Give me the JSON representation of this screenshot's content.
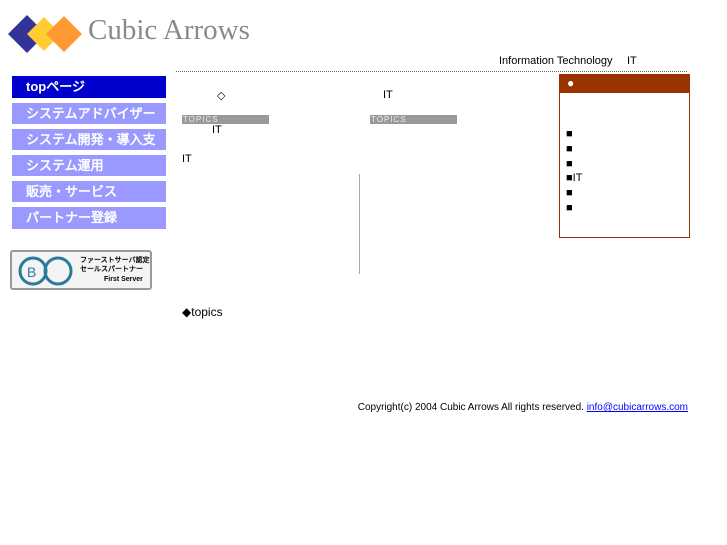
{
  "logo": {
    "text": "Cubic Arrows",
    "colors": [
      "#333399",
      "#ffcc33",
      "#ff9933"
    ]
  },
  "header": {
    "tagline": "Information Technology",
    "tag_it": "IT"
  },
  "nav": {
    "items": [
      {
        "label": "topページ",
        "active": true
      },
      {
        "label": "システムアドバイザー"
      },
      {
        "label": "システム開発・導入支援"
      },
      {
        "label": "システム運用"
      },
      {
        "label": "販売・サービス"
      },
      {
        "label": "パートナー登録"
      }
    ]
  },
  "banner": {
    "line1": "ファーストサーバ認定",
    "line2": "セールスパートナー",
    "brand": "First Server"
  },
  "main": {
    "diamond": "◇",
    "it1": "IT",
    "topics_label": "TOPICS",
    "it2": "IT",
    "it3": "IT",
    "topics_label2": "TOPICS",
    "topics_heading": "◆topics"
  },
  "sidebox": {
    "bullet": "●",
    "items": [
      "■",
      "■",
      "■",
      "■IT",
      "■",
      "■"
    ],
    "accent": "#993300"
  },
  "footer": {
    "copyright": "Copyright(c) 2004 Cubic Arrows All rights reserved.",
    "email": "info@cubicarrows.com"
  }
}
